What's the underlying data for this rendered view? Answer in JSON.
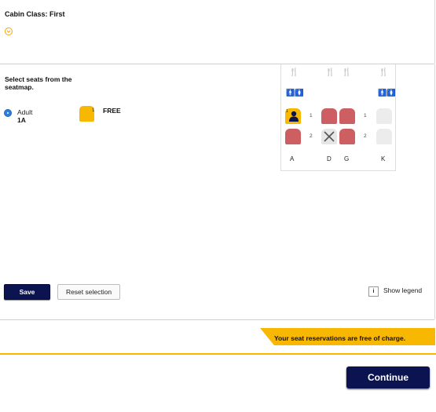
{
  "cabin": {
    "label": "Cabin Class: First"
  },
  "instructions": {
    "select_text": "Select seats from the seatmap."
  },
  "passenger": {
    "type": "Adult",
    "seat": "1A",
    "seat_chip_number": "1",
    "price": "FREE",
    "selected": true
  },
  "seatmap": {
    "columns": [
      "A",
      "D",
      "G",
      "K"
    ],
    "row_labels": [
      "1",
      "2"
    ],
    "rows": [
      {
        "row": "1",
        "seats": {
          "A": "selected",
          "D": "occupied",
          "G": "occupied",
          "K": "available"
        }
      },
      {
        "row": "2",
        "seats": {
          "A": "occupied",
          "D": "blocked",
          "G": "occupied",
          "K": "available"
        }
      }
    ],
    "facilities": [
      "galley",
      "lavatory"
    ]
  },
  "actions": {
    "save_label": "Save",
    "reset_label": "Reset selection",
    "legend_icon": "i",
    "legend_label": "Show legend",
    "continue_label": "Continue"
  },
  "notice": {
    "text": "Your seat reservations are free of charge."
  },
  "colors": {
    "accent": "#f8b700",
    "primary_button": "#0b1450",
    "occupied_seat": "#cd5f62",
    "selected_seat": "#f8b700",
    "available_seat": "#ececec",
    "radio": "#2f7fe0"
  }
}
